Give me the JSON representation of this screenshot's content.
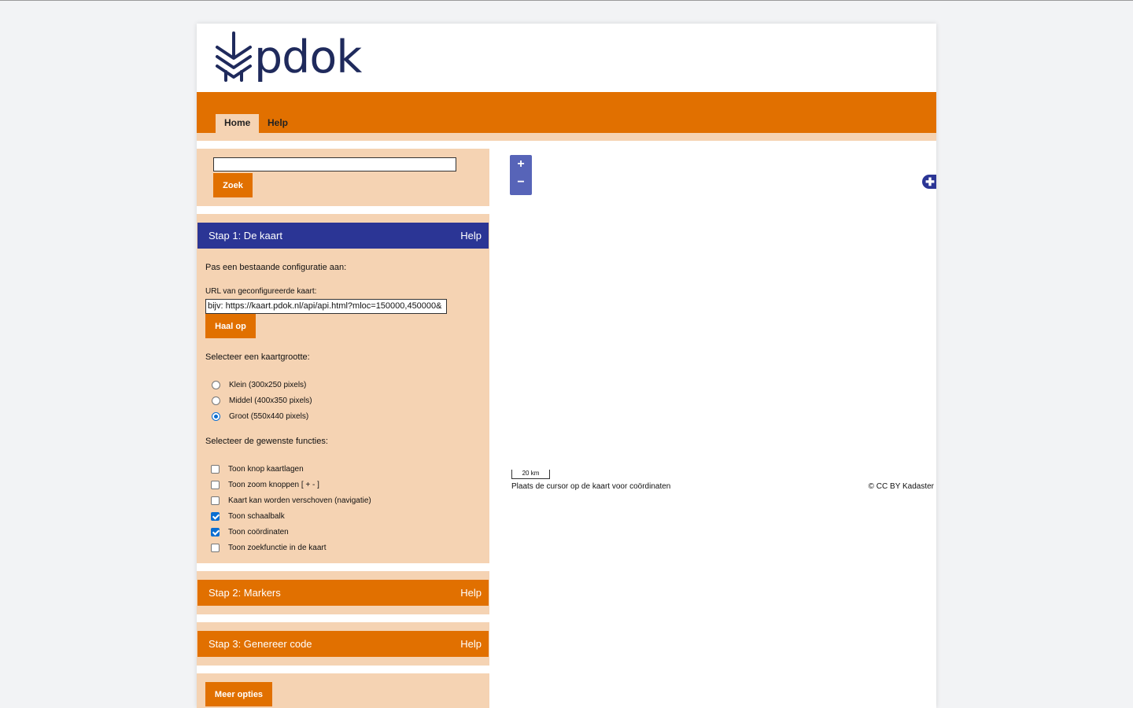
{
  "logo": {
    "text": "pdok"
  },
  "nav": {
    "home": "Home",
    "help": "Help"
  },
  "search": {
    "value": "",
    "button": "Zoek"
  },
  "step1": {
    "title": "Stap 1: De kaart",
    "help": "Help",
    "intro": "Pas een bestaande configuratie aan:",
    "url_label": "URL van geconfigureerde kaart:",
    "url_placeholder": "bijv: https://kaart.pdok.nl/api/api.html?mloc=150000,450000&",
    "fetch_button": "Haal op",
    "size_heading": "Selecteer een kaartgrootte:",
    "sizes": [
      {
        "label": "Klein (300x250 pixels)",
        "checked": false
      },
      {
        "label": "Middel (400x350 pixels)",
        "checked": false
      },
      {
        "label": "Groot (550x440 pixels)",
        "checked": true
      }
    ],
    "functions_heading": "Selecteer de gewenste functies:",
    "functions": [
      {
        "label": "Toon knop kaartlagen",
        "checked": false
      },
      {
        "label": "Toon zoom knoppen [ + - ]",
        "checked": false
      },
      {
        "label": "Kaart kan worden verschoven (navigatie)",
        "checked": false
      },
      {
        "label": "Toon schaalbalk",
        "checked": true
      },
      {
        "label": "Toon coördinaten",
        "checked": true
      },
      {
        "label": "Toon zoekfunctie in de kaart",
        "checked": false
      }
    ]
  },
  "step2": {
    "title": "Stap 2: Markers",
    "help": "Help"
  },
  "step3": {
    "title": "Stap 3: Genereer code",
    "help": "Help"
  },
  "more": {
    "button": "Meer opties"
  },
  "map": {
    "zoom_in": "+",
    "zoom_out": "−",
    "layers": "✚",
    "scale": "20 km",
    "coords_hint": "Plaats de cursor op de kaart voor coördinaten",
    "attribution": "© CC BY Kadaster"
  },
  "colors": {
    "orange": "#e17000",
    "peach": "#f5d3b3",
    "blue": "#2b3595",
    "logo": "#1f2a5c"
  }
}
